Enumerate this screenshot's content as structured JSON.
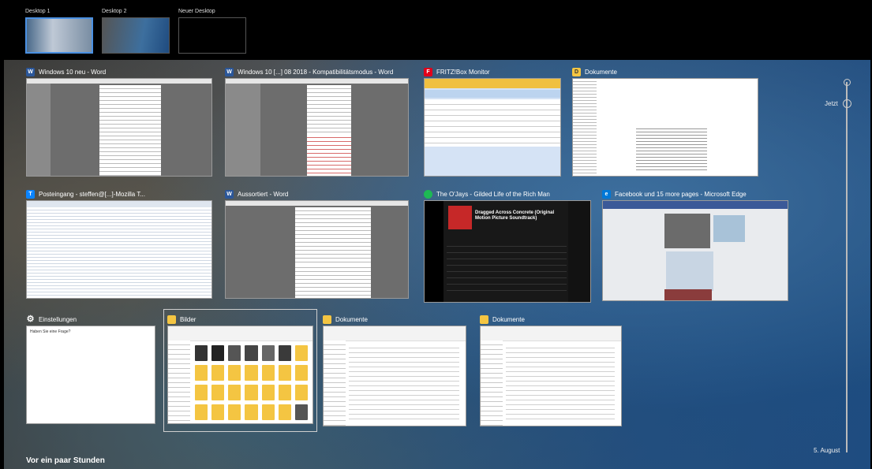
{
  "desktops": [
    {
      "label": "Desktop 1",
      "active": true
    },
    {
      "label": "Desktop 2",
      "active": false
    },
    {
      "label": "Neuer Desktop",
      "active": false
    }
  ],
  "windows": [
    {
      "title": "Windows 10 neu - Word",
      "icon": "word-icon"
    },
    {
      "title": "Windows 10 [...] 08 2018 - Kompatibilitätsmodus - Word",
      "icon": "word-icon"
    },
    {
      "title": "FRITZ!Box Monitor",
      "icon": "fritz-icon"
    },
    {
      "title": "Dokumente",
      "icon": "app-icon"
    },
    {
      "title": "Posteingang - steffen@[...]-Mozilla T...",
      "icon": "thunderbird-icon"
    },
    {
      "title": "Aussortiert - Word",
      "icon": "word-icon"
    },
    {
      "title": "The O'Jays - Gilded Life of the Rich Man",
      "icon": "spotify-icon"
    },
    {
      "title": "Facebook und 15 more pages - Microsoft Edge",
      "icon": "edge-icon"
    },
    {
      "title": "Einstellungen",
      "icon": "gear-icon"
    },
    {
      "title": "Bilder",
      "icon": "folder-icon"
    },
    {
      "title": "Dokumente",
      "icon": "folder-icon"
    },
    {
      "title": "Dokumente",
      "icon": "folder-icon"
    }
  ],
  "spotify_thumb": {
    "track_title": "Dragged Across Concrete (Original Motion Picture Soundtrack)"
  },
  "settings_thumb": {
    "question": "Haben Sie eine Frage?"
  },
  "timeline": {
    "now_label": "Jetzt",
    "date_label": "5. August"
  },
  "section_label": "Vor ein paar Stunden",
  "colors": {
    "accent": "#4a90e2",
    "word": "#2b579a",
    "spotify": "#1db954",
    "edge": "#0078d7"
  }
}
